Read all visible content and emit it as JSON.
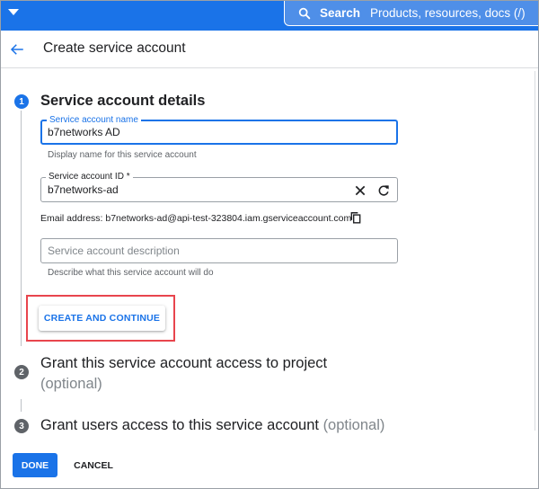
{
  "topbar": {
    "search_label": "Search",
    "search_placeholder": "Products, resources, docs (/)"
  },
  "header": {
    "title": "Create service account"
  },
  "steps": [
    {
      "number": "1",
      "title": "Service account details",
      "optional": ""
    },
    {
      "number": "2",
      "title_line1": "Grant this service account access to project",
      "optional": "(optional)"
    },
    {
      "number": "3",
      "title": "Grant users access to this service account",
      "optional": "(optional)"
    }
  ],
  "form": {
    "name_field": {
      "label": "Service account name",
      "value": "b7networks AD",
      "hint": "Display name for this service account"
    },
    "id_field": {
      "label": "Service account ID *",
      "value": "b7networks-ad"
    },
    "email_line": "Email address: b7networks-ad@api-test-323804.iam.gserviceaccount.com",
    "description_field": {
      "placeholder": "Service account description",
      "hint": "Describe what this service account will do"
    }
  },
  "buttons": {
    "create_continue": "CREATE AND CONTINUE",
    "done": "DONE",
    "cancel": "CANCEL"
  },
  "colors": {
    "primary": "#1a73e8",
    "highlight": "#e8454d",
    "step_inactive": "#5f6368"
  },
  "icons": {
    "menu": "caret-down-icon",
    "search": "search-icon",
    "back": "arrow-left-icon",
    "clear": "close-icon",
    "regenerate": "refresh-icon",
    "copy": "copy-icon"
  }
}
